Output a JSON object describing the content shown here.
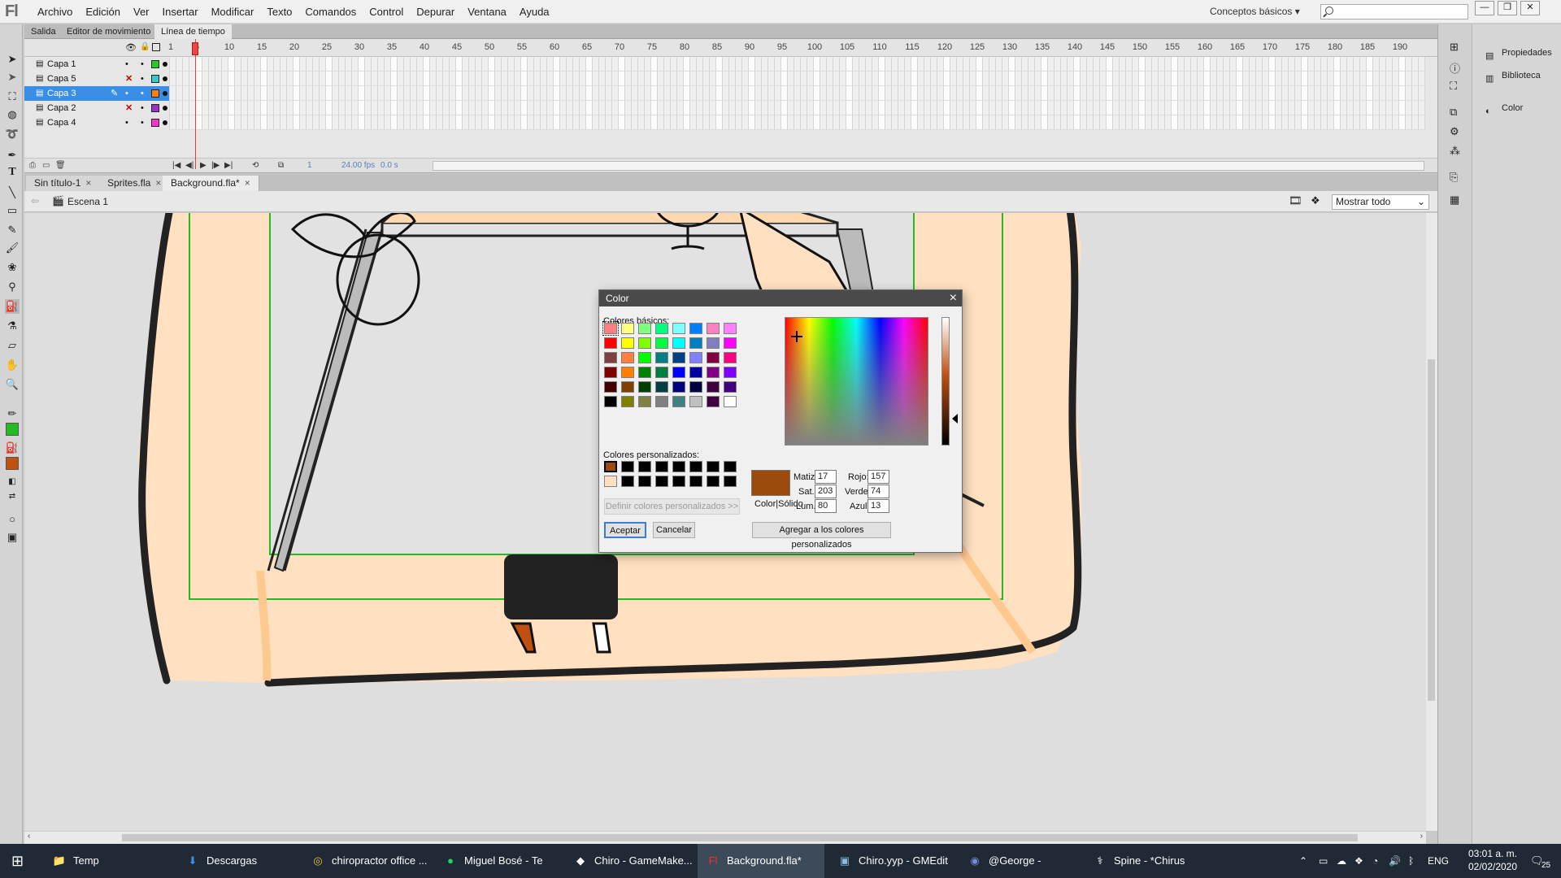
{
  "app": {
    "logo": "Fl"
  },
  "menu": [
    "Archivo",
    "Edición",
    "Ver",
    "Insertar",
    "Modificar",
    "Texto",
    "Comandos",
    "Control",
    "Depurar",
    "Ventana",
    "Ayuda"
  ],
  "workspace": {
    "label": "Conceptos básicos"
  },
  "search": {
    "placeholder": ""
  },
  "window_buttons": {
    "minimize": "—",
    "restore": "❐",
    "close": "✕"
  },
  "panel_tabs": [
    "Salida",
    "Editor de movimiento",
    "Línea de tiempo"
  ],
  "timeline": {
    "layers": [
      {
        "name": "Capa 1",
        "color": "#22cc22",
        "hidden": false,
        "selected": false
      },
      {
        "name": "Capa 5",
        "color": "#33cccc",
        "hidden": true,
        "selected": false
      },
      {
        "name": "Capa 3",
        "color": "#ff7f0e",
        "hidden": false,
        "selected": true
      },
      {
        "name": "Capa 2",
        "color": "#9933cc",
        "hidden": true,
        "selected": false
      },
      {
        "name": "Capa 4",
        "color": "#ff33cc",
        "hidden": false,
        "selected": false
      }
    ],
    "frame_numbers": [
      "1",
      "5",
      "10",
      "15",
      "20",
      "25",
      "30",
      "35",
      "40",
      "45",
      "50",
      "55",
      "60",
      "65",
      "70",
      "75",
      "80",
      "85",
      "90",
      "95",
      "100",
      "105",
      "110",
      "115",
      "120",
      "125",
      "130",
      "135",
      "140",
      "145",
      "150",
      "155",
      "160",
      "165",
      "170",
      "175",
      "180",
      "185",
      "190"
    ],
    "current_frame": "1",
    "fps": "24.00 fps",
    "time": "0.0 s"
  },
  "doc_tabs": [
    {
      "label": "Sin título-1",
      "active": false
    },
    {
      "label": "Sprites.fla",
      "active": false
    },
    {
      "label": "Background.fla*",
      "active": true
    }
  ],
  "scene": {
    "label": "Escena 1"
  },
  "zoom": {
    "value": "Mostrar todo"
  },
  "right_panels": [
    "Propiedades",
    "Biblioteca",
    "Color"
  ],
  "dialog": {
    "title": "Color",
    "basic_label": "Colores básicos:",
    "custom_label": "Colores personalizados:",
    "define_custom": "Definir colores personalizados >>",
    "ok": "Aceptar",
    "cancel": "Cancelar",
    "add_custom": "Agregar a los colores personalizados",
    "preview_label": "Color|Sólido",
    "fields": {
      "hue_label": "Matiz:",
      "hue": "17",
      "sat_label": "Sat.:",
      "sat": "203",
      "lum_label": "Lum.:",
      "lum": "80",
      "red_label": "Rojo:",
      "red": "157",
      "green_label": "Verde:",
      "green": "74",
      "blue_label": "Azul:",
      "blue": "13"
    },
    "selected_color": "#9d4a0d",
    "basic_colors": [
      [
        "#ff8080",
        "#ffff80",
        "#80ff80",
        "#00ff80",
        "#80ffff",
        "#0080ff",
        "#ff80c0",
        "#ff80ff"
      ],
      [
        "#ff0000",
        "#ffff00",
        "#80ff00",
        "#00ff40",
        "#00ffff",
        "#0080c0",
        "#8080c0",
        "#ff00ff"
      ],
      [
        "#804040",
        "#ff8040",
        "#00ff00",
        "#008080",
        "#004080",
        "#8080ff",
        "#800040",
        "#ff0080"
      ],
      [
        "#800000",
        "#ff8000",
        "#008000",
        "#008040",
        "#0000ff",
        "#0000a0",
        "#800080",
        "#8000ff"
      ],
      [
        "#400000",
        "#804000",
        "#004000",
        "#004040",
        "#000080",
        "#000040",
        "#400040",
        "#400080"
      ],
      [
        "#000000",
        "#808000",
        "#808040",
        "#808080",
        "#408080",
        "#c0c0c0",
        "#400040",
        "#ffffff"
      ]
    ],
    "custom_colors": [
      [
        "#9d4a0d",
        "#000000",
        "#000000",
        "#000000",
        "#000000",
        "#000000",
        "#000000",
        "#000000"
      ],
      [
        "#ffe0c0",
        "#000000",
        "#000000",
        "#000000",
        "#000000",
        "#000000",
        "#000000",
        "#000000"
      ]
    ]
  },
  "taskbar": {
    "items": [
      {
        "label": "Temp",
        "icon": "folder-icon",
        "active": false
      },
      {
        "label": "Descargas",
        "icon": "download-icon",
        "active": false
      },
      {
        "label": "chiropractor office ...",
        "icon": "chrome-icon",
        "active": false
      },
      {
        "label": "Miguel Bosé - Te co...",
        "icon": "spotify-icon",
        "active": false
      },
      {
        "label": "Chiro - GameMake...",
        "icon": "gamemaker-icon",
        "active": false
      },
      {
        "label": "Background.fla*",
        "icon": "flash-icon",
        "active": true
      },
      {
        "label": "Chiro.yyp - GMEdit",
        "icon": "gmedit-icon",
        "active": false
      },
      {
        "label": "@George - Discord",
        "icon": "discord-icon",
        "active": false
      },
      {
        "label": "Spine - *Chirus",
        "icon": "spine-icon",
        "active": false
      }
    ],
    "lang": "ENG",
    "time": "03:01 a. m.",
    "date": "02/02/2020",
    "notifications": "25"
  },
  "colors": {
    "accent": "#3a8ee6",
    "stage_bg": "#ffe0c0",
    "selection": "#22cc22"
  }
}
